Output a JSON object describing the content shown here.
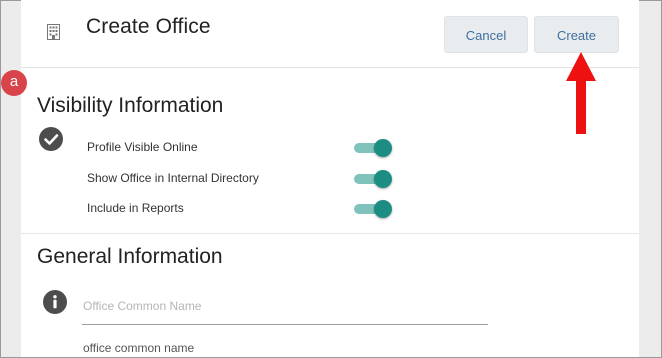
{
  "header": {
    "title": "Create Office",
    "cancel_label": "Cancel",
    "create_label": "Create"
  },
  "annotation": {
    "badge_label": "a",
    "arrow_color": "#ee1111"
  },
  "visibility": {
    "title": "Visibility Information",
    "toggles": [
      {
        "label": "Profile Visible Online",
        "on": true
      },
      {
        "label": "Show Office in Internal Directory",
        "on": true
      },
      {
        "label": "Include in Reports",
        "on": true
      }
    ]
  },
  "general": {
    "title": "General Information",
    "common_name": {
      "placeholder": "Office Common Name",
      "value": "",
      "hint": "office common name"
    }
  },
  "colors": {
    "accent": "#3e6f9e",
    "toggle_knob": "#1d8d83",
    "toggle_track": "#7fc3bc",
    "badge": "#d9444a"
  }
}
